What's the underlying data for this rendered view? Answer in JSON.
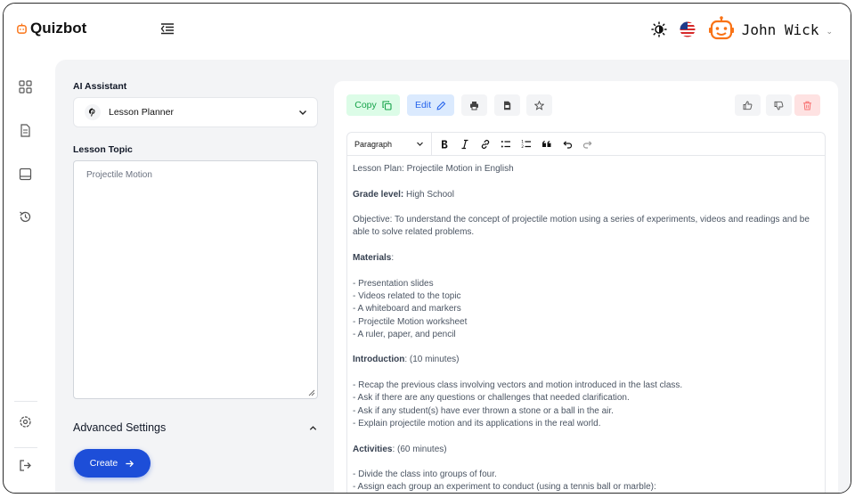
{
  "header": {
    "brand": "Quizbot",
    "user_name": "John Wick"
  },
  "left": {
    "assistant_label": "AI Assistant",
    "assistant_value": "Lesson Planner",
    "topic_label": "Lesson Topic",
    "topic_value": "Projectile Motion",
    "advanced_label": "Advanced Settings",
    "create_label": "Create"
  },
  "toolbar": {
    "copy_label": "Copy",
    "edit_label": "Edit",
    "paragraph_label": "Paragraph"
  },
  "doc": {
    "title": "Lesson Plan: Projectile Motion in English",
    "grade_key": "Grade level:",
    "grade_val": " High School",
    "objective": "Objective: To understand the concept of projectile motion using a series of experiments, videos and readings and be able to solve related problems.",
    "materials_key": "Materials",
    "materials_suffix": ":",
    "materials": [
      "- Presentation slides",
      "- Videos related to the topic",
      "- A whiteboard and markers",
      "- Projectile Motion worksheet",
      "- A ruler, paper, and pencil"
    ],
    "intro_key": "Introduction",
    "intro_suffix": ": (10 minutes)",
    "intro_items": [
      "- Recap the previous class involving vectors and motion introduced in the last class.",
      "- Ask if there are any questions or challenges that needed clarification.",
      "- Ask if any student(s) have ever thrown a stone or a ball in the air.",
      "- Explain projectile motion and its applications in the real world."
    ],
    "activities_key": "Activities",
    "activities_suffix": ": (60 minutes)",
    "activities_items": [
      "- Divide the class into groups of four.",
      "- Assign each group an experiment to conduct (using a tennis ball or marble):"
    ]
  },
  "colors": {
    "primary": "#1d4ed8",
    "copy_bg": "#dcfce7",
    "copy_fg": "#16a34a",
    "edit_bg": "#dbeafe",
    "edit_fg": "#2563eb",
    "avatar": "#f97316",
    "delete": "#f87171"
  },
  "icons": [
    "dashboard-icon",
    "document-icon",
    "inbox-icon",
    "history-icon",
    "settings-icon",
    "logout-icon",
    "theme-icon",
    "us-flag-icon",
    "robot-avatar-icon"
  ]
}
